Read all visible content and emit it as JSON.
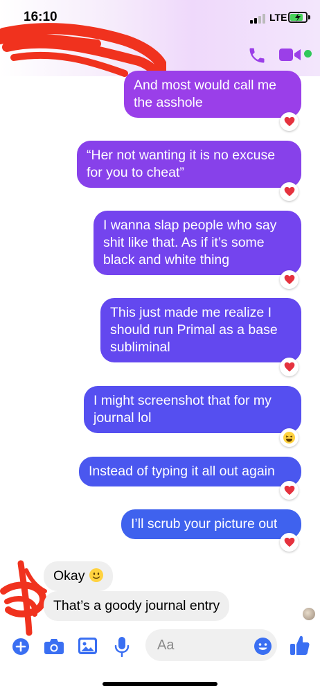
{
  "status_bar": {
    "time": "16:10",
    "network": "LTE"
  },
  "colors": {
    "bubble_top": "#9b3fe8",
    "bubble_mid": "#6f44f0",
    "bubble_bottom": "#4a59ee",
    "incoming_bubble": "#efefef",
    "accent": "#3a6ff2",
    "heart": "#e5323e",
    "scribble": "#f0321e"
  },
  "header": {
    "call_icon": "phone-icon",
    "video_icon": "video-camera-icon"
  },
  "messages": [
    {
      "direction": "out",
      "text": "And most would call me\nthe asshole",
      "reaction": "heart"
    },
    {
      "direction": "out",
      "text": "“Her not wanting it is no excuse\nfor you to cheat”",
      "reaction": "heart"
    },
    {
      "direction": "out",
      "text": "I wanna slap people who say\nshit like that. As if it’s some\nblack and white thing",
      "reaction": "heart"
    },
    {
      "direction": "out",
      "text": "This just made me realize I\nshould run Primal as a base\nsubliminal",
      "reaction": "heart"
    },
    {
      "direction": "out",
      "text": "I might screenshot that for my\njournal lol",
      "reaction": "laughing"
    },
    {
      "direction": "out",
      "text": "Instead of typing it all out again",
      "reaction": "heart"
    },
    {
      "direction": "out",
      "text": "I’ll scrub your picture out",
      "reaction": "heart"
    },
    {
      "direction": "in",
      "text": "Okay",
      "emoji": "slightly-smiling-face"
    },
    {
      "direction": "in",
      "text": "That’s a goody journal entry"
    }
  ],
  "composer": {
    "placeholder": "Aa",
    "icons": [
      "plus-icon",
      "camera-icon",
      "photo-icon",
      "microphone-icon",
      "emoji-icon",
      "thumbs-up-icon"
    ]
  }
}
